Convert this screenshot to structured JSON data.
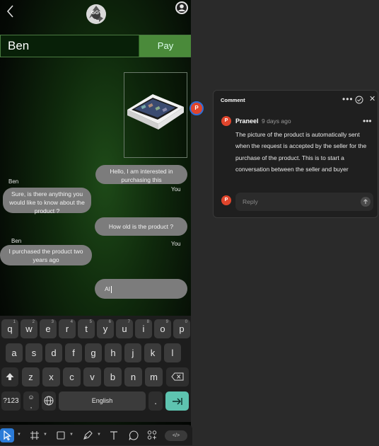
{
  "app": {
    "logo_text": "GG",
    "back_icon": "chevron-left-icon",
    "account_icon": "user-circle-icon"
  },
  "chat": {
    "name": "Ben",
    "pay_label": "Pay",
    "marker_initial": "P"
  },
  "messages": [
    {
      "sender": "",
      "text": "Hello, I am interested in purchasing this"
    },
    {
      "sender": "Ben",
      "text": "Sure, is there anything you would like to know about the product ?"
    },
    {
      "sender": "You",
      "text": "How old is the product ?"
    },
    {
      "sender": "Ben",
      "text": "I purchased the product two years ago"
    }
  ],
  "you_labels": [
    "You",
    "You"
  ],
  "composer": {
    "draft": "Al"
  },
  "keyboard": {
    "row1": [
      {
        "k": "q",
        "h": "1"
      },
      {
        "k": "w",
        "h": "2"
      },
      {
        "k": "e",
        "h": "3"
      },
      {
        "k": "r",
        "h": "4"
      },
      {
        "k": "t",
        "h": "5"
      },
      {
        "k": "y",
        "h": "6"
      },
      {
        "k": "u",
        "h": "7"
      },
      {
        "k": "i",
        "h": "8"
      },
      {
        "k": "o",
        "h": "9"
      },
      {
        "k": "p",
        "h": "0"
      }
    ],
    "row2": [
      "a",
      "s",
      "d",
      "f",
      "g",
      "h",
      "j",
      "k",
      "l"
    ],
    "row3": [
      "z",
      "x",
      "c",
      "v",
      "b",
      "n",
      "m"
    ],
    "sym": "?123",
    "emoji_top": "☺",
    "emoji_bottom": ",",
    "space": "English",
    "period": "."
  },
  "comment": {
    "title": "Comment",
    "author_initial": "P",
    "author": "Praneel",
    "time": "9 days ago",
    "body": "The picture of the product is automatically sent when the request is accepted by the seller for the purchase of the product. This is to start a conversation between the seller and buyer",
    "reply_initial": "P",
    "reply_placeholder": "Reply"
  },
  "toolbar": {
    "dev_label": "</>"
  }
}
